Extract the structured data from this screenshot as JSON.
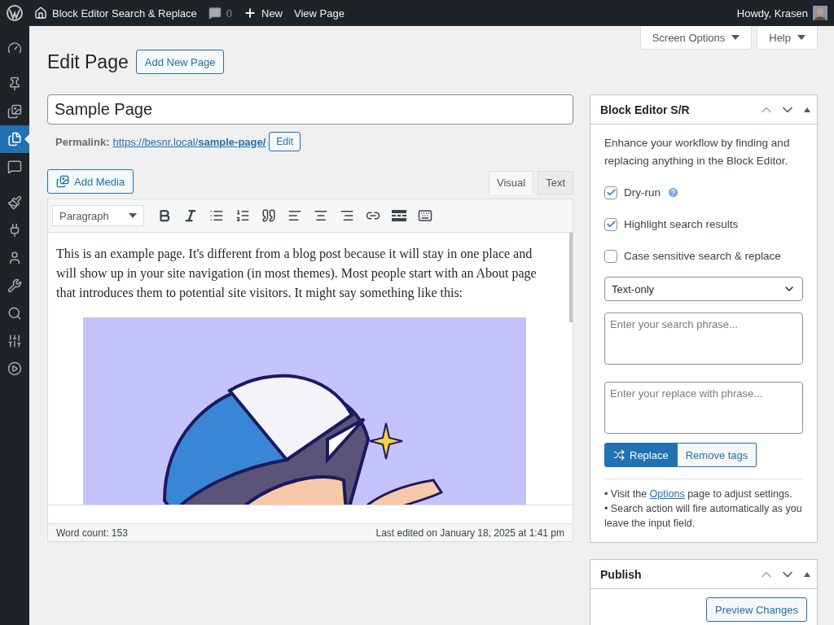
{
  "admin_bar": {
    "site_title": "Block Editor Search & Replace",
    "comments_count": "0",
    "new_label": "New",
    "view_label": "View Page",
    "greeting": "Howdy, Krasen"
  },
  "sidebar": {
    "groups": [
      [
        {
          "selected": false
        }
      ],
      [
        {
          "selected": false
        },
        {
          "selected": false
        },
        {
          "selected": true
        },
        {
          "selected": false
        }
      ],
      [
        {
          "selected": false
        },
        {
          "selected": false
        },
        {
          "selected": false
        },
        {
          "selected": false
        },
        {
          "selected": false
        },
        {
          "selected": false
        },
        {
          "selected": false
        }
      ]
    ]
  },
  "screen_meta": [
    "Screen Options",
    "Help"
  ],
  "heading": {
    "title": "Edit Page",
    "add_new": "Add New Page"
  },
  "title_field": {
    "value": "Sample Page"
  },
  "permalink": {
    "label": "Permalink:",
    "url": "https://besnr.local/**sample-page/**",
    "edit": "Edit"
  },
  "add_media": "Add Media",
  "editor_tabs": [
    {
      "label": "Visual",
      "selected": true
    },
    {
      "label": "Text",
      "selected": false
    }
  ],
  "format_select": "Paragraph",
  "content": {
    "paragraph": "This is an example page. It's different from a blog post because it will stay in one place and will show up in your site navigation (in most themes). Most people start with an About page that introduces them to potential site visitors. It might say something like this:"
  },
  "status_bar": {
    "word_count": "Word count: 153",
    "last_edited": "Last edited on January 18, 2025 at 1:41 pm"
  },
  "sr_box": {
    "title": "Block Editor S/R",
    "description": "Enhance your workflow by finding and replacing anything in the Block Editor.",
    "options": [
      {
        "label": "Dry-run",
        "checked": true,
        "help": true
      },
      {
        "label": "Highlight search results",
        "checked": true,
        "help": false
      },
      {
        "label": "Case sensitive search & replace",
        "checked": false,
        "help": false
      }
    ],
    "mode_select": "Text-only",
    "search_placeholder": "Enter your search phrase...",
    "replace_placeholder": "Enter your replace with phrase...",
    "primary_button": "Replace",
    "secondary_button": "Remove tags",
    "note_1": {
      "before": "• Visit the ",
      "link": "Options",
      "after": " page to adjust settings."
    },
    "note_2": "• Search action will fire automatically as you leave the input field."
  },
  "publish_box": {
    "title": "Publish",
    "preview_button": "Preview Changes"
  }
}
